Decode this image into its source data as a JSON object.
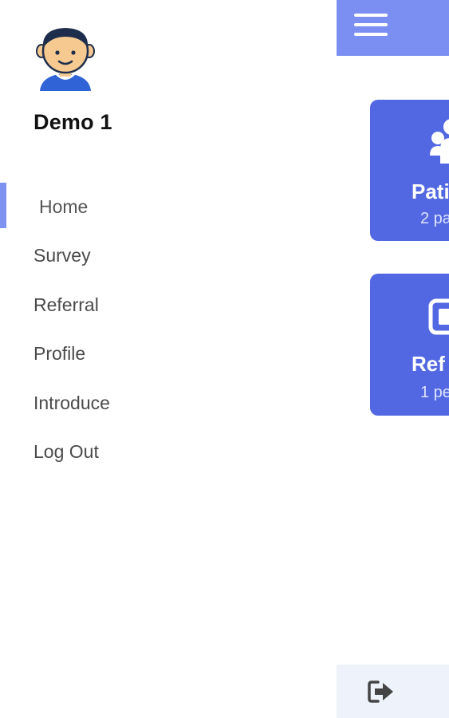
{
  "drawer": {
    "user_name": "Demo 1",
    "avatar_icon": "user-avatar-icon",
    "menu": [
      {
        "label": "Home",
        "active": true
      },
      {
        "label": "Survey",
        "active": false
      },
      {
        "label": "Referral",
        "active": false
      },
      {
        "label": "Profile",
        "active": false
      },
      {
        "label": "Introduce",
        "active": false
      },
      {
        "label": "Log Out",
        "active": false
      }
    ]
  },
  "main": {
    "menu_icon": "hamburger-icon",
    "cards": [
      {
        "title": "Pati",
        "subtitle": "2 pa",
        "icon": "people-icon"
      },
      {
        "title": "Ref",
        "subtitle": "1 pe",
        "icon": "document-icon"
      }
    ],
    "bottom_icon": "logout-icon"
  },
  "colors": {
    "primary": "#5268e2",
    "appbar": "#7b8ff2",
    "active_indicator": "#7e93f1",
    "bottom_bar": "#eef2fb"
  }
}
